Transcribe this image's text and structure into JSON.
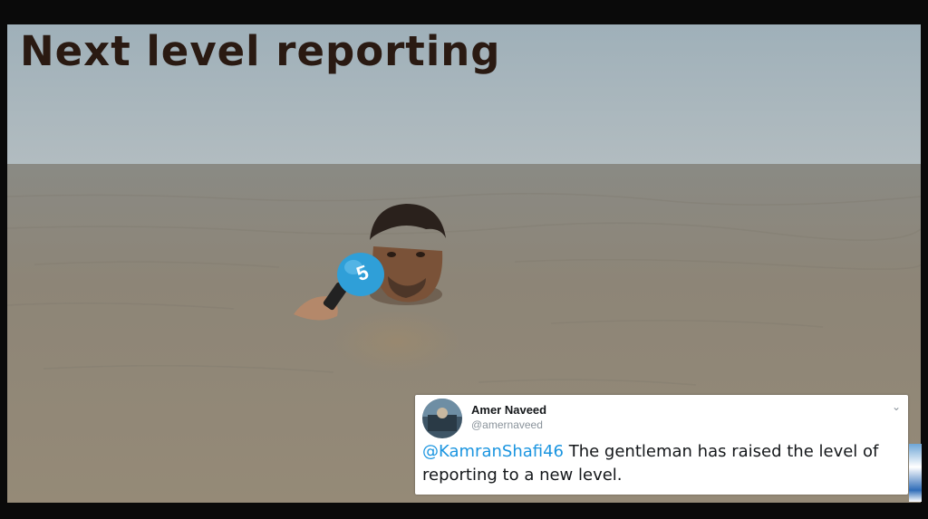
{
  "headline": "Next level reporting",
  "tweet": {
    "author_name": "Amer Naveed",
    "author_handle": "@amernaveed",
    "mention": "@KamranShafi46",
    "text": " The gentleman has raised the level of reporting to a new level.",
    "menu_icon": "chevron-down-icon"
  },
  "microphone_logo": "5",
  "colors": {
    "sky": "#a9b6bc",
    "water": "#8f8676",
    "headline_text": "#2a1a12",
    "mention": "#1b95e0",
    "mic": "#2f9fd8"
  }
}
